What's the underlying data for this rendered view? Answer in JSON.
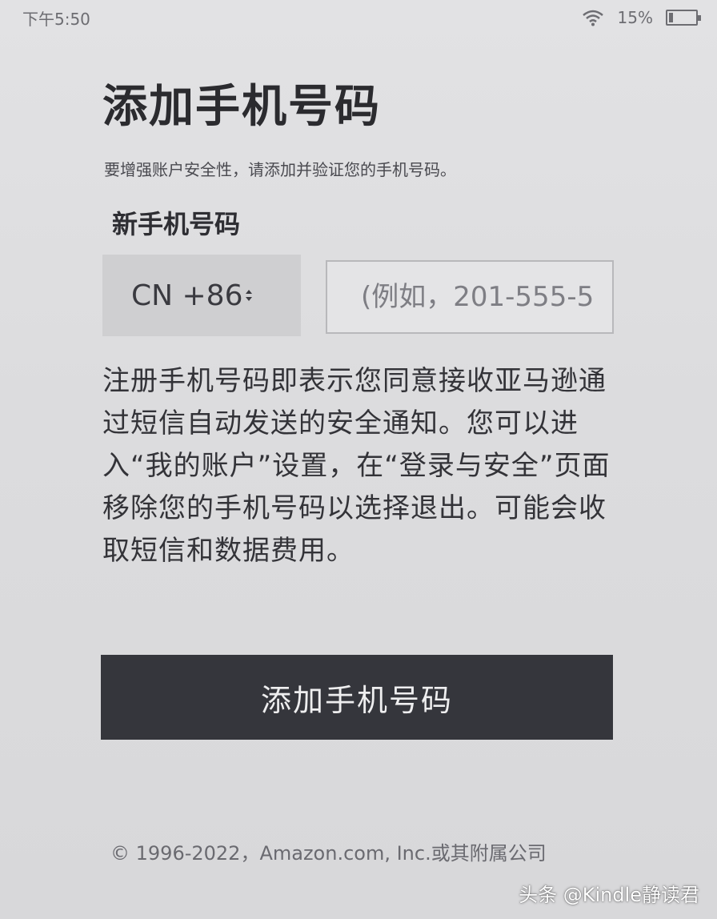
{
  "status_bar": {
    "time": "下午5:50",
    "battery_percent": "15%",
    "battery_level": 0.15,
    "wifi_icon": "wifi-icon",
    "battery_icon": "battery-icon"
  },
  "page": {
    "title": "添加手机号码",
    "subtitle": "要增强账户安全性，请添加并验证您的手机号码。"
  },
  "form": {
    "field_label": "新手机号码",
    "country_code": "CN +86",
    "country_icon": "chevron-updown-icon",
    "phone_placeholder": "(例如，201-555-5",
    "phone_value": ""
  },
  "terms": {
    "text": "注册手机号码即表示您同意接收亚马逊通过短信自动发送的安全通知。您可以进入“我的账户”设置，在“登录与安全”页面移除您的手机号码以选择退出。可能会收取短信和数据费用。"
  },
  "actions": {
    "add_button_label": "添加手机号码"
  },
  "footer": {
    "copyright": "© 1996-2022，Amazon.com, Inc.或其附属公司"
  },
  "watermark": {
    "text": "头条 @Kindle静读君"
  },
  "colors": {
    "background": "#dcdcde",
    "button_bg": "#35363c",
    "button_text": "#eeeeef",
    "country_bg": "#cfcfd1"
  }
}
